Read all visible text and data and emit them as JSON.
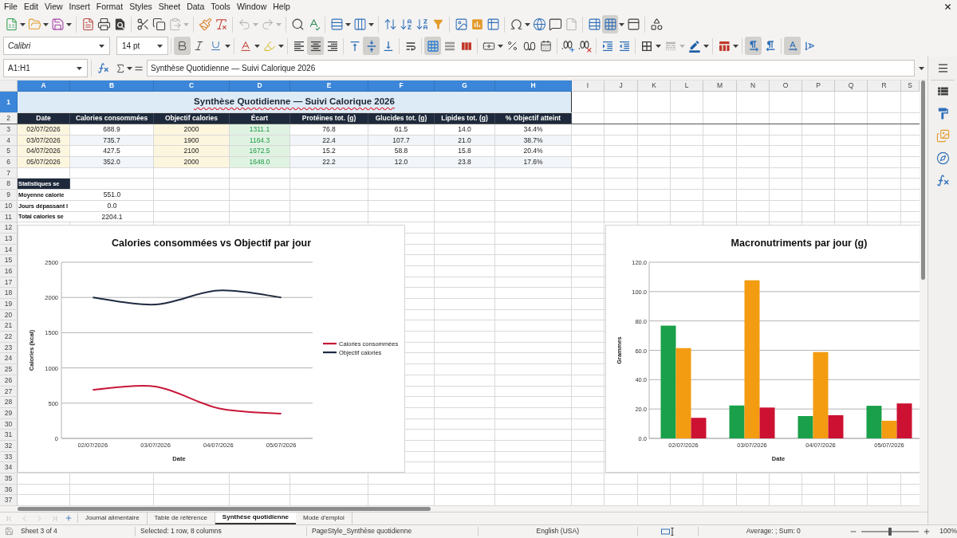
{
  "menu_bar": {
    "items": [
      "File",
      "Edit",
      "View",
      "Insert",
      "Format",
      "Styles",
      "Sheet",
      "Data",
      "Tools",
      "Window",
      "Help"
    ]
  },
  "standard_toolbar": {
    "paste_disabled": true,
    "undo_disabled": true,
    "redo_disabled": true,
    "freeze_rows_and_columns": true
  },
  "formatting_toolbar": {
    "font_name": "Calibri",
    "font_size": "14 pt",
    "bold": true,
    "italic": false,
    "underline": false,
    "align_left": false,
    "align_center": true,
    "align_right": false,
    "align_top": false,
    "align_middle": true,
    "align_bottom": false,
    "merge_and_center": true,
    "paragraph_ltr": true,
    "paragraph_rtl": false,
    "text_horizontal": true,
    "text_vertical": false
  },
  "formula_bar": {
    "name_box": "A1:H1",
    "value": "Synthèse Quotidienne — Suivi Calorique 2026"
  },
  "sheet": {
    "column_headers": [
      {
        "label": "A",
        "selected": true
      },
      {
        "label": "B",
        "selected": true
      },
      {
        "label": "C",
        "selected": true
      },
      {
        "label": "D",
        "selected": true
      },
      {
        "label": "E",
        "selected": true
      },
      {
        "label": "F",
        "selected": true
      },
      {
        "label": "G",
        "selected": true
      },
      {
        "label": "H",
        "selected": true
      },
      {
        "label": "I",
        "selected": false
      },
      {
        "label": "J",
        "selected": false
      },
      {
        "label": "K",
        "selected": false
      },
      {
        "label": "L",
        "selected": false
      },
      {
        "label": "M",
        "selected": false
      },
      {
        "label": "N",
        "selected": false
      },
      {
        "label": "O",
        "selected": false
      },
      {
        "label": "P",
        "selected": false
      },
      {
        "label": "Q",
        "selected": false
      },
      {
        "label": "R",
        "selected": false
      },
      {
        "label": "S",
        "selected": false
      }
    ],
    "row_headers": [
      {
        "label": "1",
        "selected": true
      },
      {
        "label": "2",
        "selected": false
      },
      {
        "label": "3",
        "selected": false
      },
      {
        "label": "4",
        "selected": false
      },
      {
        "label": "5",
        "selected": false
      },
      {
        "label": "6",
        "selected": false
      },
      {
        "label": "7",
        "selected": false
      },
      {
        "label": "8",
        "selected": false
      },
      {
        "label": "9",
        "selected": false
      },
      {
        "label": "10",
        "selected": false
      },
      {
        "label": "11",
        "selected": false
      },
      {
        "label": "12",
        "selected": false
      },
      {
        "label": "13",
        "selected": false
      },
      {
        "label": "14",
        "selected": false
      },
      {
        "label": "15",
        "selected": false
      },
      {
        "label": "16",
        "selected": false
      },
      {
        "label": "17",
        "selected": false
      },
      {
        "label": "18",
        "selected": false
      },
      {
        "label": "19",
        "selected": false
      },
      {
        "label": "20",
        "selected": false
      },
      {
        "label": "21",
        "selected": false
      },
      {
        "label": "22",
        "selected": false
      },
      {
        "label": "23",
        "selected": false
      },
      {
        "label": "24",
        "selected": false
      },
      {
        "label": "25",
        "selected": false
      },
      {
        "label": "26",
        "selected": false
      },
      {
        "label": "27",
        "selected": false
      },
      {
        "label": "28",
        "selected": false
      },
      {
        "label": "29",
        "selected": false
      },
      {
        "label": "30",
        "selected": false
      },
      {
        "label": "31",
        "selected": false
      },
      {
        "label": "32",
        "selected": false
      },
      {
        "label": "33",
        "selected": false
      },
      {
        "label": "34",
        "selected": false
      },
      {
        "label": "35",
        "selected": false
      },
      {
        "label": "36",
        "selected": false
      },
      {
        "label": "37",
        "selected": false
      }
    ],
    "title": "Synthèse Quotidienne — Suivi Calorique 2026",
    "table": {
      "columns": [
        {
          "label": "Date",
          "kind": "date"
        },
        {
          "label": "Calories consommées",
          "kind": "plain"
        },
        {
          "label": "Objectif calories",
          "kind": "target"
        },
        {
          "label": "Écart",
          "kind": "difference"
        },
        {
          "label": "Protéines tot. (g)",
          "kind": "plain"
        },
        {
          "label": "Glucides tot. (g)",
          "kind": "plain"
        },
        {
          "label": "Lipides tot. (g)",
          "kind": "plain"
        },
        {
          "label": "% Objectif atteint",
          "kind": "plain"
        }
      ],
      "rows": [
        [
          "02/07/2026",
          "688.9",
          "2000",
          "1311.1",
          "76.8",
          "61.5",
          "14.0",
          "34.4%"
        ],
        [
          "03/07/2026",
          "735.7",
          "1900",
          "1164.3",
          "22.4",
          "107.7",
          "21.0",
          "38.7%"
        ],
        [
          "04/07/2026",
          "427.5",
          "2100",
          "1672.5",
          "15.2",
          "58.8",
          "15.8",
          "20.4%"
        ],
        [
          "05/07/2026",
          "352.0",
          "2000",
          "1648.0",
          "22.2",
          "12.0",
          "23.8",
          "17.6%"
        ]
      ]
    },
    "stats": {
      "heading": "Statistiques se",
      "rows": [
        {
          "label": "Moyenne calorie",
          "value": "551.0"
        },
        {
          "label": "Jours dépassant l",
          "value": "0.0"
        },
        {
          "label": "Total calories se",
          "value": "2204.1"
        }
      ]
    }
  },
  "charts": [
    {
      "chart_data": {
        "type": "line",
        "title": "Calories consommées vs Objectif par jour",
        "xlabel": "Date",
        "ylabel": "Calories (kcal)",
        "categories": [
          "02/07/2026",
          "03/07/2026",
          "04/07/2026",
          "05/07/2026"
        ],
        "series": [
          {
            "name": "Calories consommées",
            "color": "#c8173a",
            "values": [
              688.9,
              735.7,
              427.5,
              352.0
            ]
          },
          {
            "name": "Objectif calories",
            "color": "#1f2a40",
            "values": [
              2000,
              1900,
              2100,
              2000
            ]
          }
        ],
        "ylim": [
          0,
          2500
        ],
        "yticks": [
          {
            "value": 0,
            "label": "0"
          },
          {
            "value": 500,
            "label": "500"
          },
          {
            "value": 1000,
            "label": "1000"
          },
          {
            "value": 1500,
            "label": "1500"
          },
          {
            "value": 2000,
            "label": "2000"
          },
          {
            "value": 2500,
            "label": "2500"
          }
        ],
        "grid": true,
        "legend": "right"
      }
    },
    {
      "chart_data": {
        "type": "bar",
        "title": "Macronutriments par jour (g)",
        "xlabel": "Date",
        "ylabel": "Grammes",
        "categories": [
          "02/07/2026",
          "03/07/2026",
          "04/07/2026",
          "05/07/2026"
        ],
        "series": [
          {
            "color": "#1aa04a",
            "values": [
              76.8,
              22.4,
              15.2,
              22.2
            ]
          },
          {
            "color": "#f39c12",
            "values": [
              61.5,
              107.7,
              58.8,
              12.0
            ]
          },
          {
            "color": "#cc1133",
            "values": [
              14.0,
              21.0,
              15.8,
              23.8
            ]
          }
        ],
        "ylim": [
          0,
          120
        ],
        "yticks": [
          {
            "value": 0,
            "label": "0.0"
          },
          {
            "value": 20,
            "label": "20.0"
          },
          {
            "value": 40,
            "label": "40.0"
          },
          {
            "value": 60,
            "label": "60.0"
          },
          {
            "value": 80,
            "label": "80.0"
          },
          {
            "value": 100,
            "label": "100.0"
          },
          {
            "value": 120,
            "label": "120.0"
          }
        ],
        "grid": true
      }
    }
  ],
  "sheet_tabs": [
    {
      "label": "Journal alimentaire",
      "selected": false
    },
    {
      "label": "Table de référence",
      "selected": false
    },
    {
      "label": "Synthèse quotidienne",
      "selected": true
    },
    {
      "label": "Mode d'emploi",
      "selected": false
    }
  ],
  "status_bar": {
    "sheet": "Sheet 3 of 4",
    "selection": "Selected: 1 row, 8 columns",
    "page_style": "PageStyle_Synthèse quotidienne",
    "language": "English (USA)",
    "summary": "Average: ; Sum: 0",
    "zoom": {
      "level": 0.5,
      "reading": "100%"
    }
  }
}
